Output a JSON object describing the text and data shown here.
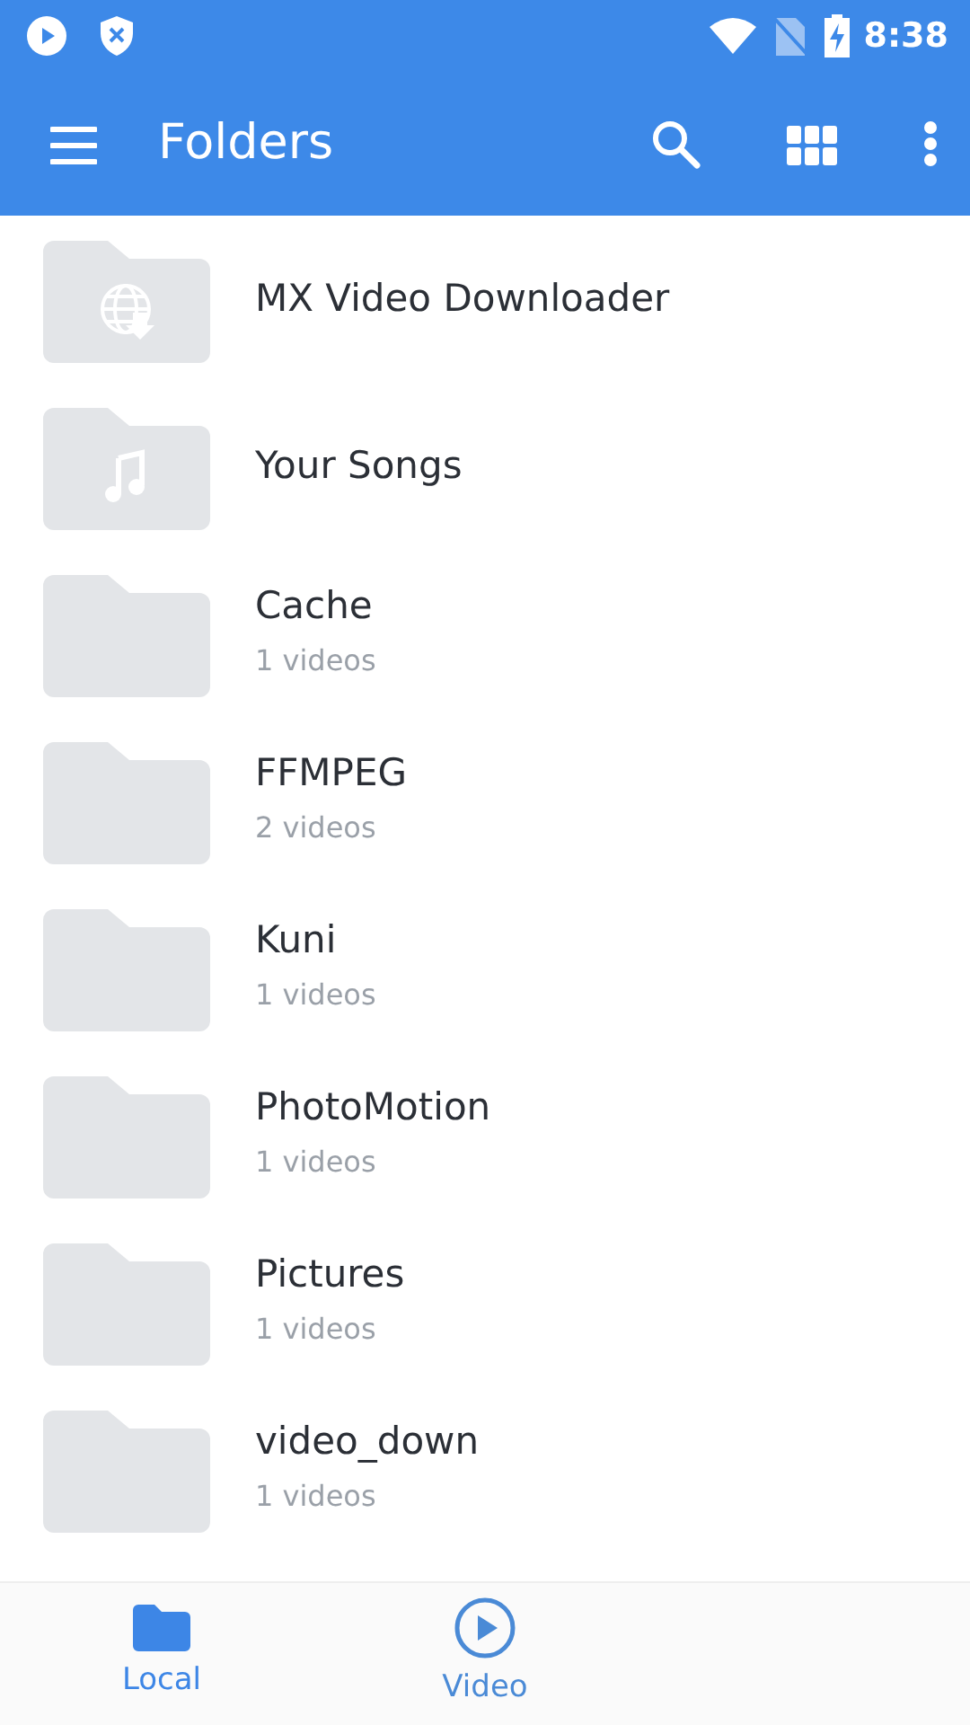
{
  "status_bar": {
    "time": "8:38"
  },
  "toolbar": {
    "title": "Folders"
  },
  "folders": [
    {
      "name": "MX Video Downloader",
      "kind": "download"
    },
    {
      "name": "Your Songs",
      "kind": "music"
    },
    {
      "name": "Cache",
      "kind": "folder",
      "count": "1 videos"
    },
    {
      "name": "FFMPEG",
      "kind": "folder",
      "count": "2 videos"
    },
    {
      "name": "Kuni",
      "kind": "folder",
      "count": "1 videos"
    },
    {
      "name": "PhotoMotion",
      "kind": "folder",
      "count": "1 videos"
    },
    {
      "name": "Pictures",
      "kind": "folder",
      "count": "1 videos"
    },
    {
      "name": "video_down",
      "kind": "folder",
      "count": "1 videos"
    }
  ],
  "bottom_tabs": [
    {
      "label": "Local",
      "kind": "folder",
      "selected": true
    },
    {
      "label": "Video",
      "kind": "play",
      "selected": false
    }
  ]
}
